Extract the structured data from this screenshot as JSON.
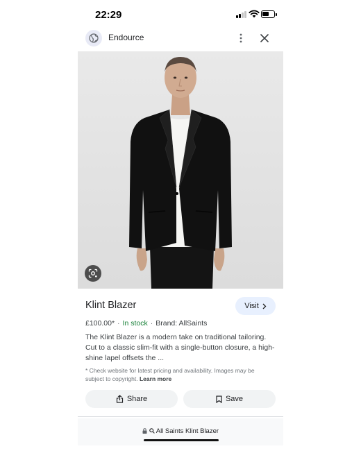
{
  "status_bar": {
    "time": "22:29"
  },
  "header": {
    "site_name": "Endource"
  },
  "product": {
    "title": "Klint Blazer",
    "visit_label": "Visit",
    "price": "£100.00*",
    "stock": "In stock",
    "brand": "Brand: AllSaints",
    "description": "The Klint Blazer is a modern take on traditional tailoring. Cut to a classic slim-fit with a single-button closure, a high-shine lapel offsets the ...",
    "disclaimer": "* Check website for latest pricing and availability. Images may be subject to copyright.",
    "learn_more": "Learn more"
  },
  "actions": {
    "share_label": "Share",
    "save_label": "Save"
  },
  "url_bar": {
    "query": "All Saints Klint Blazer"
  },
  "icons": {
    "globe": "globe-icon",
    "more": "more-vert-icon",
    "close": "close-icon",
    "lens": "lens-icon",
    "chevron": "chevron-right-icon",
    "share": "share-icon",
    "bookmark": "bookmark-icon",
    "lock": "lock-icon",
    "search": "search-icon"
  },
  "colors": {
    "in_stock": "#188038",
    "visit_bg": "#e8f0fe",
    "button_bg": "#f1f3f4",
    "globe_badge": "#e8eaf6"
  }
}
